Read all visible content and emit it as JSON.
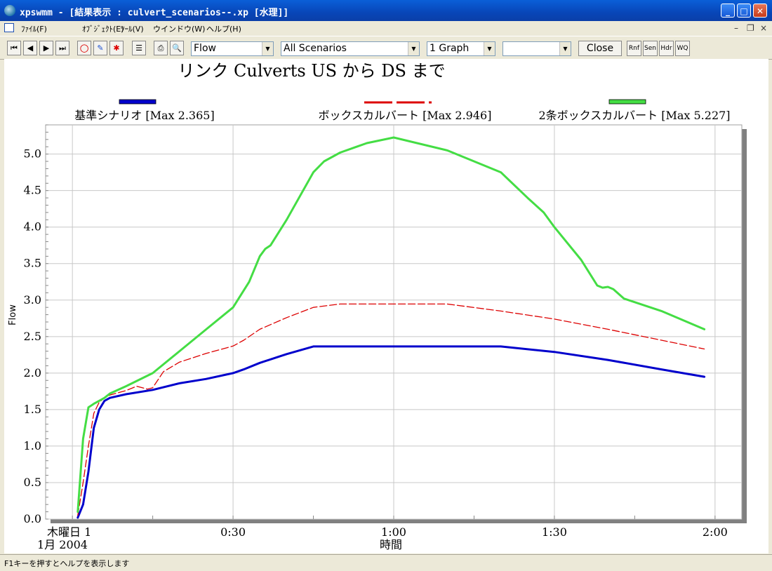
{
  "window": {
    "title": "xpswmm - [結果表示 : culvert_scenarios--.xp [水理]]",
    "minimize": "_",
    "maximize": "□",
    "close": "✕"
  },
  "menu": [
    "ﾌｧｲﾙ(F)",
    "ｵﾌﾞｼﾞｪｸﾄ(E)",
    "ﾂｰﾙ(V)",
    "ウインドウ(W)",
    "ヘルプ(H)"
  ],
  "toolbar": {
    "variable": "Flow",
    "scenarios": "All Scenarios",
    "graphs": "1 Graph",
    "blank_select": "",
    "close_label": "Close",
    "small_buttons": [
      "Rnf",
      "Sen",
      "Hdr",
      "WQ"
    ]
  },
  "status": "F1キーを押すとヘルプを表示します",
  "chart_data": {
    "type": "line",
    "title": "リンク Culverts US から DS まで",
    "xlabel": "時間",
    "ylabel": "Flow",
    "date_label": [
      "木曜日 1",
      "1月 2004"
    ],
    "xlim_minutes": [
      -5,
      125
    ],
    "ylim": [
      0,
      5.4
    ],
    "yticks": [
      0.0,
      0.5,
      1.0,
      1.5,
      2.0,
      2.5,
      3.0,
      3.5,
      4.0,
      4.5,
      5.0
    ],
    "ytick_labels": [
      "0.0",
      "0.5",
      "1.0",
      "1.5",
      "2.0",
      "2.5",
      "3.0",
      "3.5",
      "4.0",
      "4.5",
      "5.0"
    ],
    "xticks_minutes": [
      0,
      30,
      60,
      90,
      120
    ],
    "xtick_labels": [
      "",
      "0:30",
      "1:00",
      "1:30",
      "2:00"
    ],
    "grid": true,
    "legend_position": "top",
    "series": [
      {
        "name": "基準シナリオ [Max 2.365]",
        "color": "#0000cc",
        "style": "solid-thick",
        "x": [
          1,
          2,
          3,
          4,
          5,
          6,
          7,
          10,
          15,
          20,
          25,
          30,
          32,
          35,
          40,
          45,
          60,
          80,
          90,
          100,
          110,
          118
        ],
        "y": [
          0.02,
          0.2,
          0.65,
          1.25,
          1.5,
          1.62,
          1.66,
          1.71,
          1.77,
          1.86,
          1.92,
          2.0,
          2.05,
          2.14,
          2.26,
          2.365,
          2.365,
          2.365,
          2.29,
          2.18,
          2.05,
          1.95
        ]
      },
      {
        "name": "ボックスカルバート [Max 2.946]",
        "color": "#dd0000",
        "style": "dashed",
        "x": [
          1,
          2,
          3,
          4,
          5,
          6,
          7,
          10,
          12,
          14,
          15,
          17,
          20,
          25,
          30,
          32,
          35,
          40,
          45,
          50,
          60,
          70,
          80,
          90,
          100,
          110,
          118
        ],
        "y": [
          0.05,
          0.5,
          1.0,
          1.45,
          1.6,
          1.66,
          1.7,
          1.76,
          1.82,
          1.78,
          1.8,
          2.02,
          2.15,
          2.27,
          2.37,
          2.45,
          2.6,
          2.76,
          2.9,
          2.946,
          2.946,
          2.946,
          2.85,
          2.74,
          2.6,
          2.45,
          2.33
        ]
      },
      {
        "name": "2条ボックスカルバート [Max 5.227]",
        "color": "#44dd44",
        "style": "solid-thick",
        "x": [
          1,
          2,
          3,
          4,
          5,
          6,
          7,
          10,
          15,
          20,
          25,
          30,
          33,
          35,
          36,
          37,
          40,
          45,
          47,
          50,
          55,
          60,
          70,
          80,
          85,
          88,
          90,
          95,
          98,
          99,
          100,
          101,
          103,
          110,
          118
        ],
        "y": [
          0.1,
          1.1,
          1.53,
          1.58,
          1.62,
          1.66,
          1.72,
          1.82,
          2.0,
          2.3,
          2.6,
          2.9,
          3.25,
          3.6,
          3.7,
          3.75,
          4.1,
          4.75,
          4.9,
          5.02,
          5.15,
          5.227,
          5.05,
          4.75,
          4.4,
          4.2,
          4.0,
          3.55,
          3.2,
          3.17,
          3.18,
          3.15,
          3.02,
          2.85,
          2.6
        ]
      }
    ]
  }
}
